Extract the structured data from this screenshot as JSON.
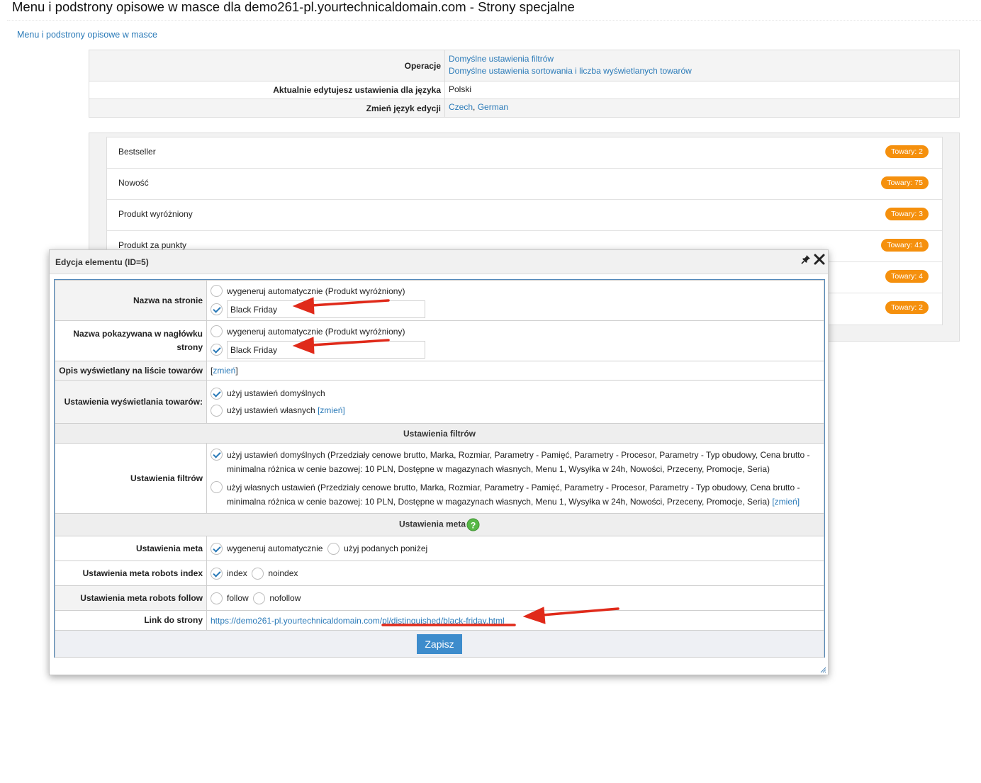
{
  "page_title": "Menu i podstrony opisowe w masce dla demo261-pl.yourtechnicaldomain.com - Strony specjalne",
  "breadcrumb": "Menu i podstrony opisowe w masce",
  "info": {
    "operations_label": "Operacje",
    "operations_links": [
      "Domyślne ustawienia filtrów",
      "Domyślne ustawienia sortowania i liczba wyświetlanych towarów"
    ],
    "language_label": "Aktualnie edytujesz ustawienia dla języka",
    "language_value": "Polski",
    "change_label": "Zmień język edycji",
    "change_links": [
      "Czech",
      "German"
    ],
    "separator": ", "
  },
  "list": [
    {
      "name": "Bestseller",
      "badge": "Towary: 2"
    },
    {
      "name": "Nowość",
      "badge": "Towary: 75"
    },
    {
      "name": "Produkt wyróżniony",
      "badge": "Towary: 3"
    },
    {
      "name": "Produkt za punkty",
      "badge": "Towary: 41"
    },
    {
      "name": "",
      "badge": "Towary: 4"
    },
    {
      "name": "",
      "badge": "Towary: 2"
    }
  ],
  "dialog": {
    "title": "Edycja elementu (ID=5)",
    "name_on_page": {
      "label": "Nazwa na stronie",
      "auto_option": "wygeneruj automatycznie (Produkt wyróżniony)",
      "value": "Black Friday"
    },
    "name_in_header": {
      "label_line1": "Nazwa pokazywana w nagłówku",
      "label_line2": "strony",
      "auto_option": "wygeneruj automatycznie (Produkt wyróżniony)",
      "value": "Black Friday"
    },
    "description": {
      "label": "Opis wyświetlany na liście towarów",
      "link": "zmień",
      "open": "[",
      "close": "]"
    },
    "display_settings": {
      "label": "Ustawienia wyświetlania towarów:",
      "default_option": "użyj ustawień domyślnych",
      "own_option": "użyj ustawień własnych",
      "link": "[zmień]"
    },
    "filters_section": "Ustawienia filtrów",
    "filters": {
      "label": "Ustawienia filtrów",
      "default_option": "użyj ustawień domyślnych (Przedziały cenowe brutto, Marka, Rozmiar, Parametry - Pamięć, Parametry - Procesor, Parametry - Typ obudowy, Cena brutto - minimalna różnica w cenie bazowej: 10 PLN, Dostępne w magazynach własnych, Menu 1, Wysyłka w 24h, Nowości, Przeceny, Promocje, Seria)",
      "own_option": "użyj własnych ustawień (Przedziały cenowe brutto, Marka, Rozmiar, Parametry - Pamięć, Parametry - Procesor, Parametry - Typ obudowy, Cena brutto - minimalna różnica w cenie bazowej: 10 PLN, Dostępne w magazynach własnych, Menu 1, Wysyłka w 24h, Nowości, Przeceny, Promocje, Seria)",
      "link": "[zmień]"
    },
    "meta_section": "Ustawienia meta",
    "meta": {
      "label": "Ustawienia meta",
      "auto_option": "wygeneruj automatycznie",
      "custom_option": "użyj podanych poniżej"
    },
    "robots_index": {
      "label": "Ustawienia meta robots index",
      "option1": "index",
      "option2": "noindex"
    },
    "robots_follow": {
      "label": "Ustawienia meta robots follow",
      "option1": "follow",
      "option2": "nofollow"
    },
    "link": {
      "label": "Link do strony",
      "url": "https://demo261-pl.yourtechnicaldomain.com/pl/distinguished/black-friday.html"
    },
    "save_label": "Zapisz"
  },
  "colors": {
    "accent": "#2a7ab8",
    "badge": "#f5900d",
    "annotation_arrow": "#e02a1a",
    "save_button": "#3d8ccc"
  },
  "icons": [
    "pin-icon",
    "close-icon",
    "help-icon",
    "resize-handle-icon",
    "check-icon"
  ]
}
